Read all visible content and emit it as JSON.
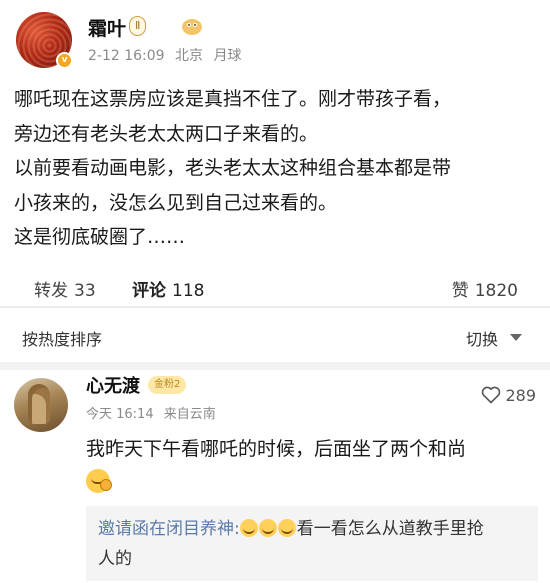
{
  "post": {
    "username": "霜叶",
    "level_badge": "Ⅱ",
    "date": "2-12 16:09",
    "location": "北京",
    "device": "月球",
    "lines": [
      "哪吒现在这票房应该是真挡不住了。刚才带孩子看，",
      "旁边还有老头老太太两口子来看的。",
      "以前要看动画电影，老头老太太这种组合基本都是带",
      "小孩来的，没怎么见到自己过来看的。",
      "这是彻底破圈了……"
    ]
  },
  "actions": {
    "repost_label": "转发",
    "repost_count": "33",
    "comment_label": "评论",
    "comment_count": "118",
    "like_label": "赞",
    "like_count": "1820"
  },
  "sort": {
    "label": "按热度排序",
    "switch_label": "切换"
  },
  "comment": {
    "name": "心无渡",
    "badge": "金粉2",
    "date": "今天 16:14",
    "location": "来自云南",
    "likes": "289",
    "text": "我昨天下午看哪吒的时候，后面坐了两个和尚",
    "reply": {
      "name": "邀请函在闭目养神:",
      "text_line1": "看一看怎么从道教手里抢",
      "text_line2": "人的"
    }
  }
}
